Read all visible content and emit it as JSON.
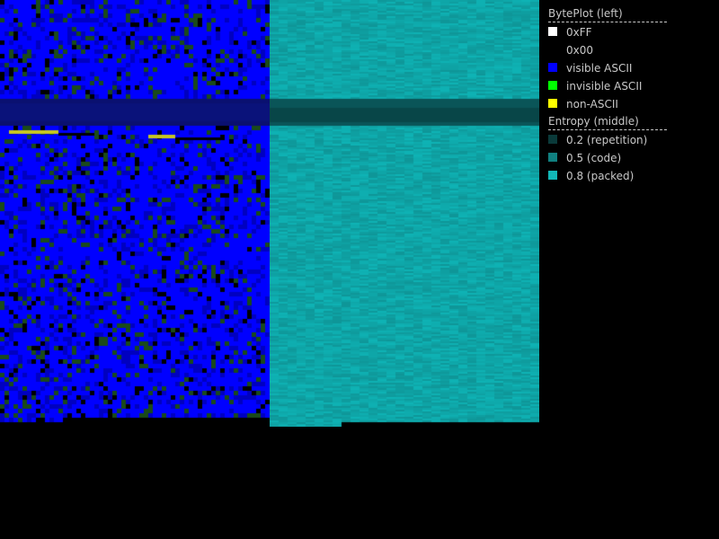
{
  "byteplot": {
    "heading": "BytePlot (left)",
    "items": [
      {
        "label": "0xFF",
        "color": "#ffffff"
      },
      {
        "label": "0x00",
        "color": "#000000"
      },
      {
        "label": "visible ASCII",
        "color": "#0000ff"
      },
      {
        "label": "invisible ASCII",
        "color": "#00ff00"
      },
      {
        "label": "non-ASCII",
        "color": "#ffff00"
      }
    ]
  },
  "entropy": {
    "heading": "Entropy (middle)",
    "items": [
      {
        "label": "0.2 (repetition)",
        "color": "#0a3a3a"
      },
      {
        "label": "0.5 (code)",
        "color": "#108080"
      },
      {
        "label": "0.8 (packed)",
        "color": "#12b8b8"
      }
    ]
  },
  "colors": {
    "background": "#000000",
    "visible_ascii": "#0000ff",
    "visible_ascii_dark": "#0000c0",
    "invisible_ascii": "#1a4a1a",
    "non_ascii": "#c8c820",
    "entropy_packed": "#12a8a8",
    "entropy_dark": "#0a4a4a"
  }
}
